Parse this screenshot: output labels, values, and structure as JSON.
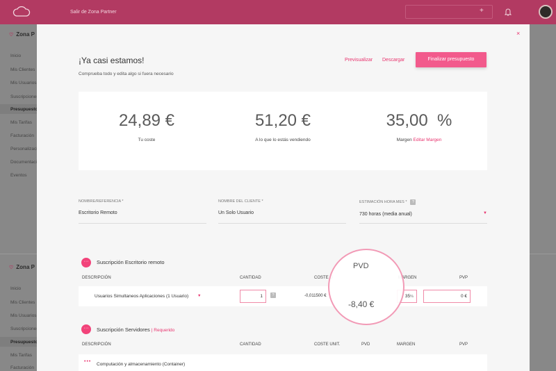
{
  "topbar": {
    "exit_label": "Salir de Zona Partner",
    "plus": "+"
  },
  "sidebar": {
    "title": "Zona P",
    "items": [
      "Inicio",
      "Mis Clientes",
      "Mis Usuarios",
      "Suscripciones",
      "Presupuestos",
      "Mis Tarifas",
      "Facturación",
      "Personalización",
      "Documentación",
      "Eventos"
    ],
    "lower_items": [
      "Inicio",
      "Mis Clientes",
      "Mis Usuarios",
      "Suscripciones",
      "Presupuestos",
      "Mis Tarifas",
      "Facturación"
    ]
  },
  "modal": {
    "close": "×",
    "title": "¡Ya casi estamos!",
    "subtitle": "Comprueba todo y edita algo si fuera necesario",
    "preview_label": "Previsualizar",
    "download_label": "Descargar",
    "finalize_label": "Finalizar presupuesto"
  },
  "stats": [
    {
      "value": "24,89 €",
      "label": "Tu coste"
    },
    {
      "value": "51,20 €",
      "label": "A lo que lo estás vendiendo"
    },
    {
      "value": "35,00  %",
      "label": "Margen",
      "link": "Editar Margen"
    }
  ],
  "fields": {
    "reference": {
      "label": "Nombre/Referencia *",
      "value": "Escritorio Remoto"
    },
    "client": {
      "label": "Nombre del cliente *",
      "value": "Un Solo Usuario"
    },
    "hours": {
      "label": "Estimación hora mes *",
      "value": "730 horas (media anual)",
      "help": "?"
    }
  },
  "section1": {
    "title": "Suscripción Escritorio remoto",
    "headers": {
      "desc": "Descripción",
      "qty": "Cantidad",
      "cost": "Coste u",
      "margin": "Margen",
      "pvp": "PVP"
    },
    "row": {
      "name": "Usuarios Simultaneos Aplicaciones (1 Usuario)",
      "qty": "1",
      "help": "?",
      "cost": "-0,011500 €",
      "margin": "35",
      "margin_unit": "%",
      "pvp": "0 €"
    }
  },
  "magnifier": {
    "label": "PVD",
    "value": "-8,40 €"
  },
  "section2": {
    "title": "Suscripción Servidores",
    "required": "| Requerido",
    "headers": {
      "desc": "Descripción",
      "qty": "Cantidad",
      "cost": "Coste unit.",
      "pvd": "PVD",
      "margin": "Margen",
      "pvp": "PVP"
    },
    "row": {
      "name": "Computación y almacenamiento (Container)"
    }
  },
  "colors": {
    "brand": "#b23a62",
    "accent": "#e8336e",
    "primary_button": "#f25a8c"
  }
}
